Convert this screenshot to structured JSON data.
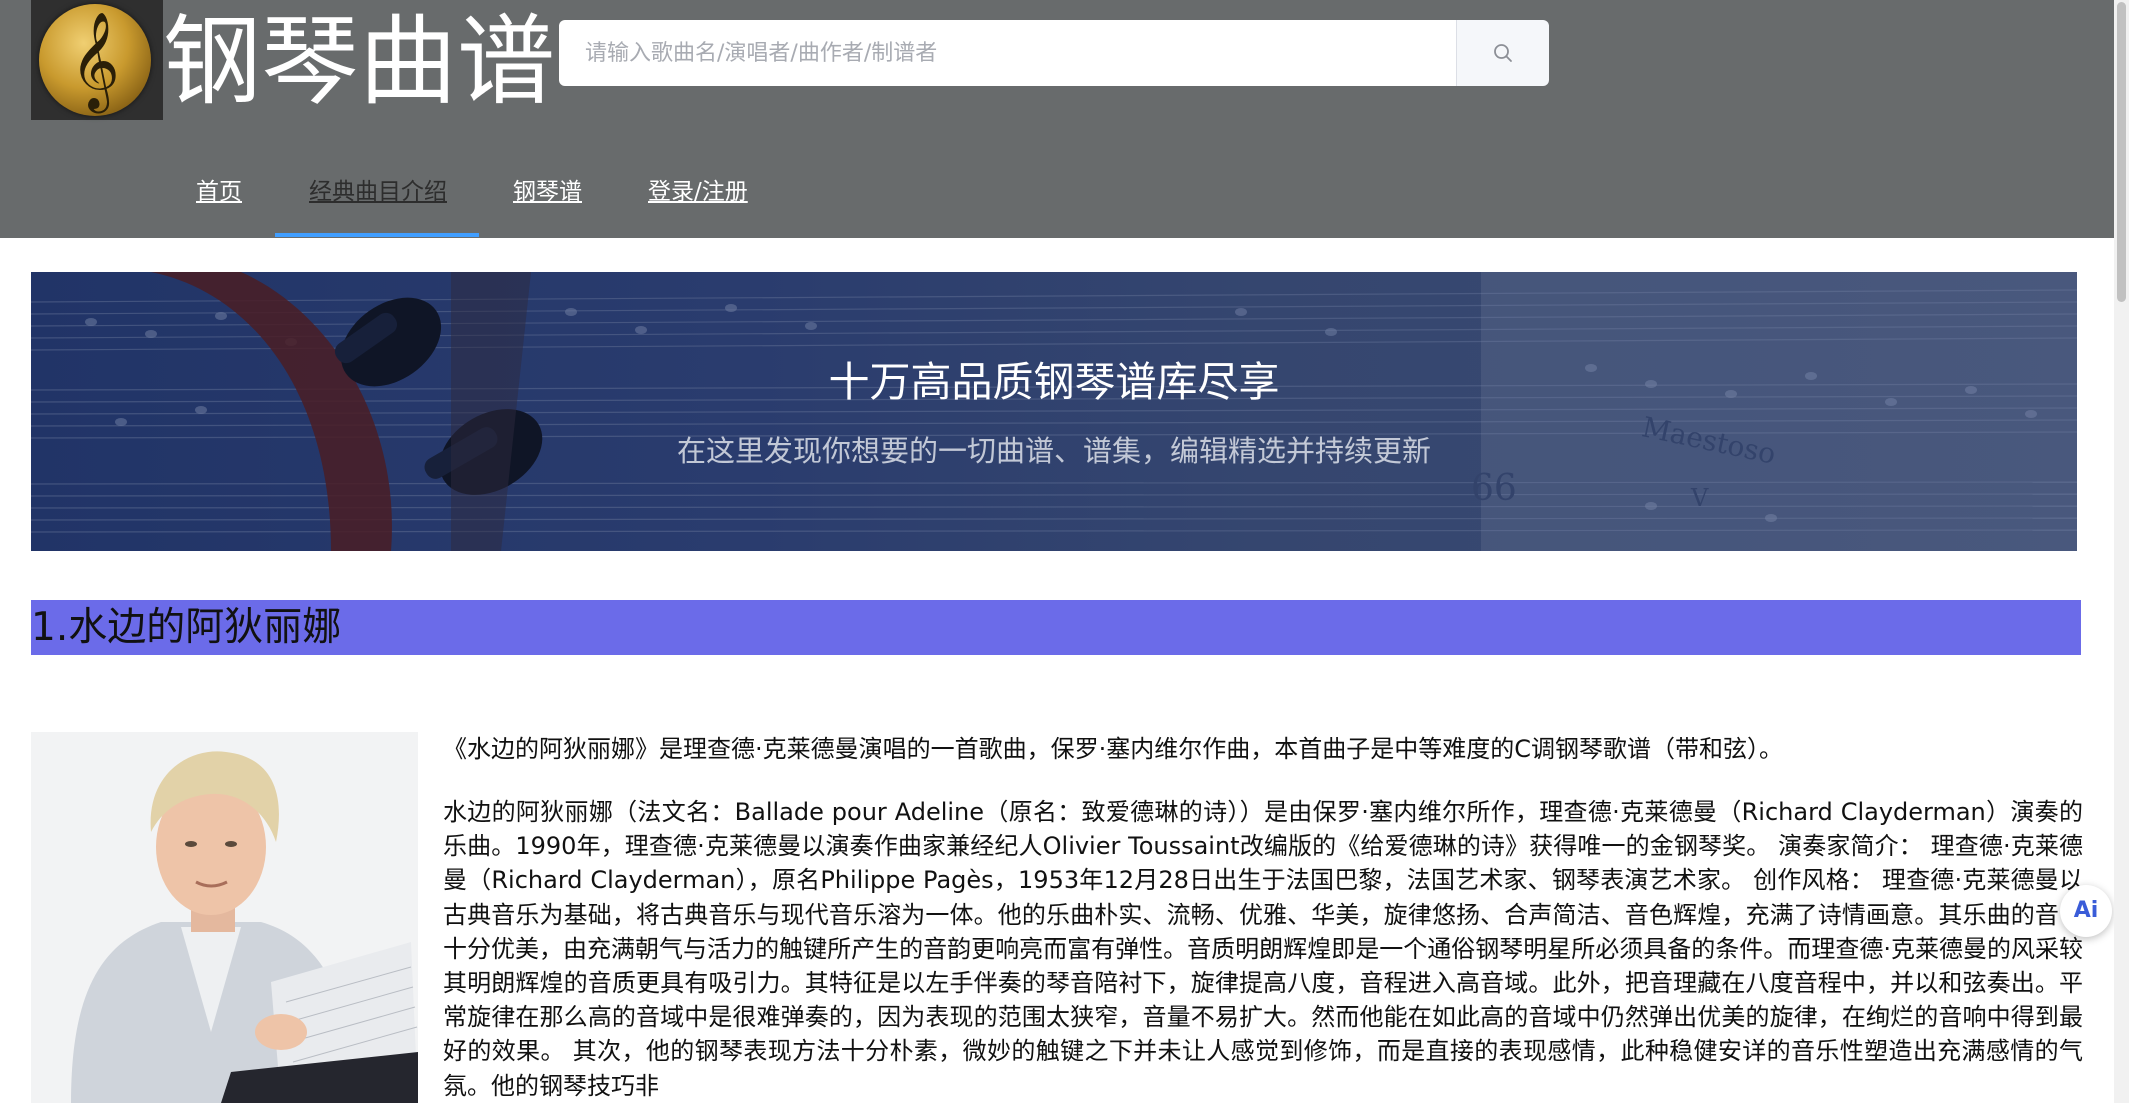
{
  "header": {
    "logo_glyph": "𝄞",
    "site_title": "钢琴曲谱",
    "search": {
      "placeholder": "请输入歌曲名/演唱者/曲作者/制谱者",
      "value": ""
    }
  },
  "nav": {
    "items": [
      {
        "label": "首页"
      },
      {
        "label": "经典曲目介绍",
        "active": true
      },
      {
        "label": "钢琴谱"
      },
      {
        "label": "登录/注册"
      }
    ]
  },
  "banner": {
    "title": "十万高品质钢琴谱库尽享",
    "subtitle": "在这里发现你想要的一切曲谱、谱集，编辑精选并持续更新",
    "score_text_tempo": "Maestoso",
    "score_text_number": "66",
    "score_text_v": "V"
  },
  "section": {
    "heading": "1.水边的阿狄丽娜",
    "intro": "《水边的阿狄丽娜》是理查德·克莱德曼演唱的一首歌曲，保罗·塞内维尔作曲，本首曲子是中等难度的C调钢琴歌谱（带和弦）。",
    "description": "水边的阿狄丽娜（法文名：Ballade pour Adeline（原名：致爱德琳的诗））是由保罗·塞内维尔所作，理查德·克莱德曼（Richard Clayderman）演奏的乐曲。1990年，理查德·克莱德曼以演奏作曲家兼经纪人Olivier Toussaint改编版的《给爱德琳的诗》获得唯一的金钢琴奖。 演奏家简介： 理查德·克莱德曼（Richard Clayderman），原名Philippe Pagès，1953年12月28日出生于法国巴黎，法国艺术家、钢琴表演艺术家。 创作风格： 理查德·克莱德曼以古典音乐为基础，将古典音乐与现代音乐溶为一体。他的乐曲朴实、流畅、优雅、华美，旋律悠扬、合声简洁、音色辉煌，充满了诗情画意。其乐曲的音色十分优美，由充满朝气与活力的触键所产生的音韵更响亮而富有弹性。音质明朗辉煌即是一个通俗钢琴明星所必须具备的条件。而理查德·克莱德曼的风采较其明朗辉煌的音质更具有吸引力。其特征是以左手伴奏的琴音陪衬下，旋律提高八度，音程进入高音域。此外，把音理藏在八度音程中，并以和弦奏出。平常旋律在那么高的音域中是很难弹奏的，因为表现的范围太狭窄，音量不易扩大。然而他能在如此高的音域中仍然弹出优美的旋律，在绚烂的音响中得到最好的效果。 其次，他的钢琴表现方法十分朴素，微妙的触键之下并未让人感觉到修饰，而是直接的表现感情，此种稳健安详的音乐性塑造出充满感情的气氛。他的钢琴技巧非"
  },
  "floating": {
    "ai_label": "Ai"
  },
  "icons": {
    "search": "search-icon",
    "logo": "treble-clef-icon",
    "ai": "ai-assistant-icon"
  },
  "colors": {
    "header_bg": "#686b6c",
    "nav_active_underline": "#409eff",
    "section_heading_bg": "#6b6be9",
    "banner_bg": "#2a3c6e"
  }
}
